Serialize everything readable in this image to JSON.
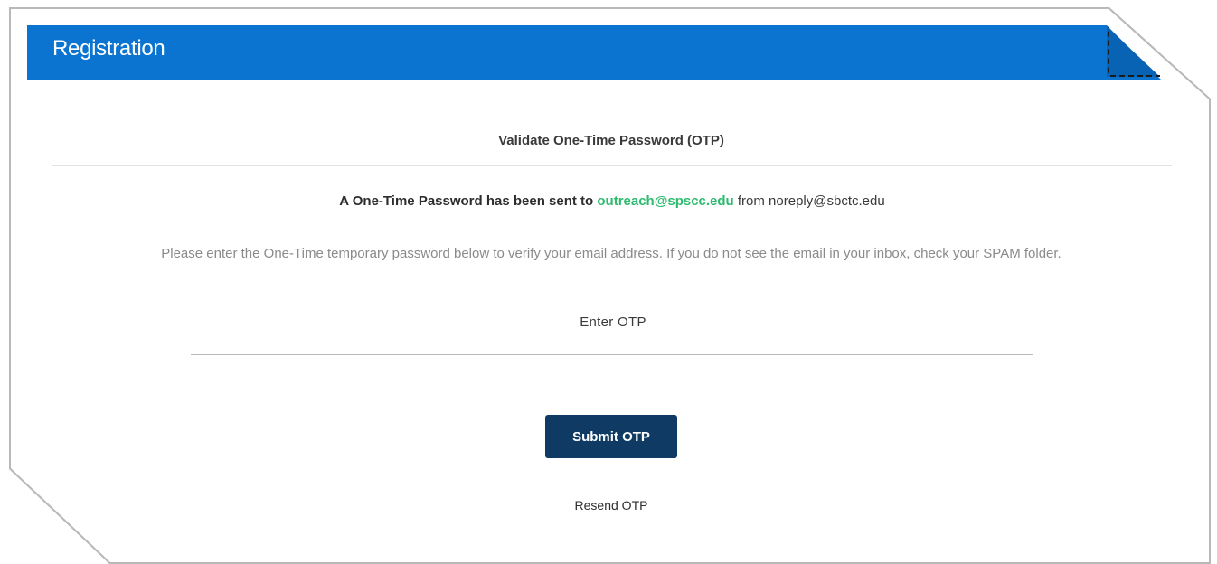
{
  "header": {
    "title": "Registration",
    "color": "#0a74d0"
  },
  "otp": {
    "subtitle": "Validate One-Time Password (OTP)",
    "sent_prefix": "A One-Time Password has been sent to ",
    "email": "outreach@spscc.edu",
    "sent_suffix": " from noreply@sbctc.edu",
    "info": "Please enter the One-Time temporary password below to verify your email address. If you do not see the email in your inbox, check your SPAM folder.",
    "input_label": "Enter OTP",
    "input_value": "",
    "submit_label": "Submit OTP",
    "resend_label": "Resend OTP",
    "button_color": "#0e3a63",
    "email_color": "#2dbb6e"
  }
}
